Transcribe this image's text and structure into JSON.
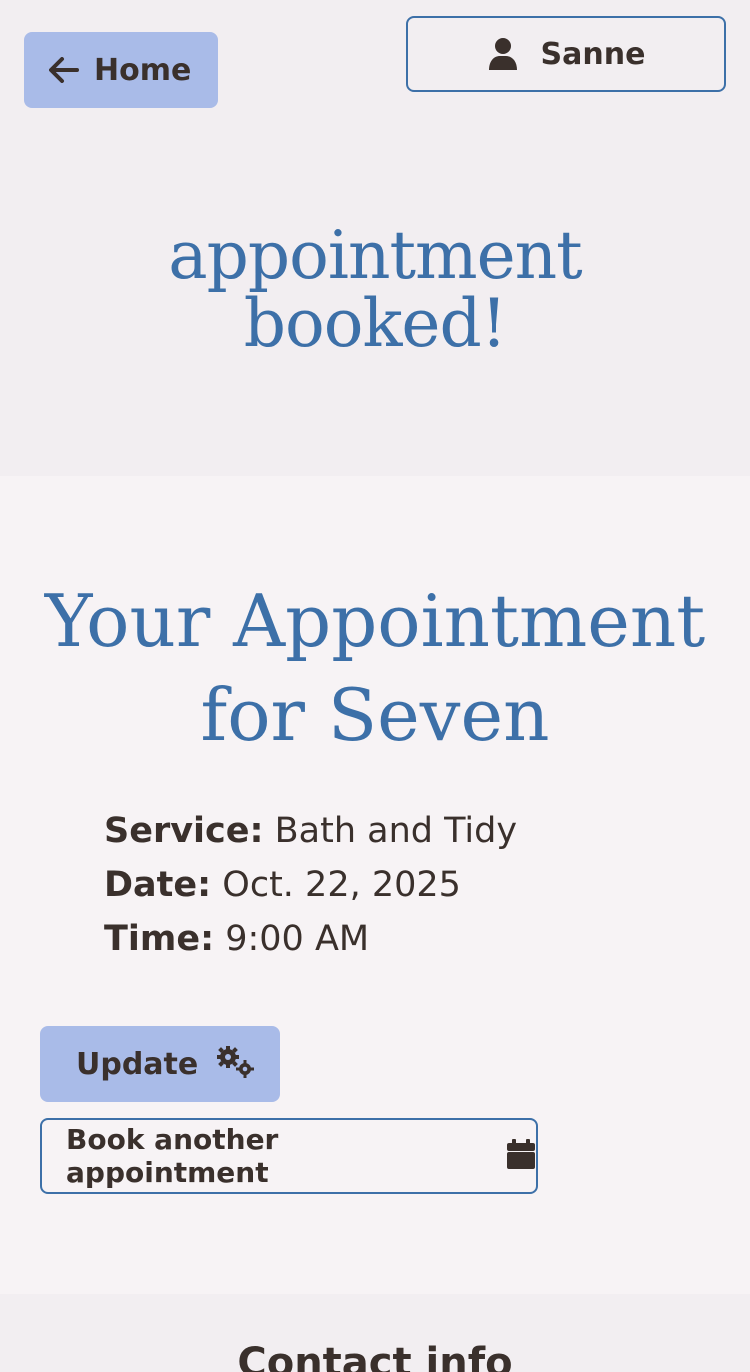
{
  "header": {
    "home_label": "Home",
    "user_name": "Sanne"
  },
  "hero": {
    "title_line1": "appointment",
    "title_line2": "booked!"
  },
  "appointment": {
    "title_line1": "Your Appointment",
    "title_line2": "for Seven",
    "service_label": "Service:",
    "service_value": "Bath and Tidy",
    "date_label": "Date:",
    "date_value": "Oct. 22, 2025",
    "time_label": "Time:",
    "time_value": "9:00 AM"
  },
  "actions": {
    "update_label": "Update",
    "book_label": "Book another appointment"
  },
  "footer": {
    "title": "Contact info"
  },
  "icons": {
    "home": "arrow-left-icon",
    "user": "user-icon",
    "update": "gears-icon",
    "book": "calendar-icon"
  },
  "colors": {
    "accent": "#3d70a8",
    "button_fill": "#a9bbe8",
    "text": "#3a302c",
    "background": "#f2eef1",
    "card_background": "#f7f3f5"
  }
}
